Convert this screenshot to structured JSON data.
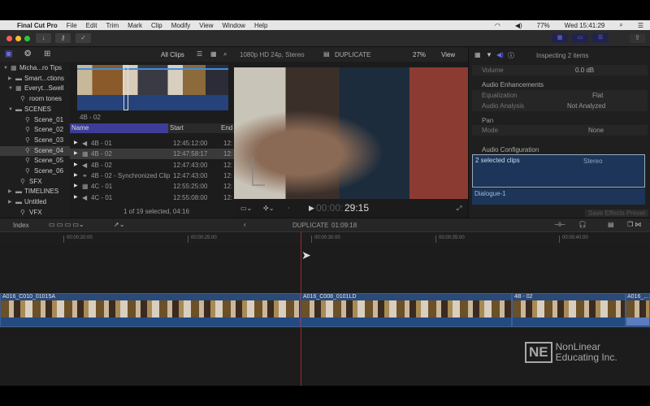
{
  "menubar": {
    "apple": "",
    "app": "Final Cut Pro",
    "items": [
      "File",
      "Edit",
      "Trim",
      "Mark",
      "Clip",
      "Modify",
      "View",
      "Window",
      "Help"
    ],
    "battery": "77%",
    "clock": "Wed 15:41:29"
  },
  "browser": {
    "filter": "All Clips",
    "sidebar": [
      {
        "label": "Micha...ro Tips",
        "indent": 0,
        "arrow": "▼",
        "icon": "library"
      },
      {
        "label": "Smart...ctions",
        "indent": 1,
        "arrow": "▶",
        "icon": "folder"
      },
      {
        "label": "Everyt...Swell",
        "indent": 1,
        "arrow": "▼",
        "icon": "event"
      },
      {
        "label": "room tones",
        "indent": 2,
        "arrow": "",
        "icon": "keyword"
      },
      {
        "label": "SCENES",
        "indent": 1,
        "arrow": "▼",
        "icon": "folder"
      },
      {
        "label": "Scene_01",
        "indent": 3,
        "arrow": "",
        "icon": "keyword"
      },
      {
        "label": "Scene_02",
        "indent": 3,
        "arrow": "",
        "icon": "keyword"
      },
      {
        "label": "Scene_03",
        "indent": 3,
        "arrow": "",
        "icon": "keyword"
      },
      {
        "label": "Scene_04",
        "indent": 3,
        "arrow": "",
        "icon": "keyword",
        "selected": true
      },
      {
        "label": "Scene_05",
        "indent": 3,
        "arrow": "",
        "icon": "keyword"
      },
      {
        "label": "Scene_06",
        "indent": 3,
        "arrow": "",
        "icon": "keyword"
      },
      {
        "label": "SFX",
        "indent": 2,
        "arrow": "",
        "icon": "keyword"
      },
      {
        "label": "TIMELINES",
        "indent": 1,
        "arrow": "▶",
        "icon": "folder"
      },
      {
        "label": "Untitled",
        "indent": 1,
        "arrow": "▶",
        "icon": "folder"
      },
      {
        "label": "VFX",
        "indent": 2,
        "arrow": "",
        "icon": "keyword"
      }
    ],
    "filmstrip_label": "4B - 02",
    "columns": [
      "Name",
      "Start",
      "End"
    ],
    "rows": [
      {
        "icon": "◀",
        "name": "4B - 01",
        "start": "12:45:12:00",
        "end": "12:"
      },
      {
        "icon": "▦",
        "name": "4B - 02",
        "start": "12:47:58:17",
        "end": "12:",
        "selected": true
      },
      {
        "icon": "◀",
        "name": "4B - 02",
        "start": "12:47:43:00",
        "end": "12:"
      },
      {
        "icon": "⚭",
        "name": "4B - 02 - Synchronized Clip",
        "start": "12:47:43:00",
        "end": "12:"
      },
      {
        "icon": "▦",
        "name": "4C - 01",
        "start": "12:55:25:00",
        "end": "12:"
      },
      {
        "icon": "◀",
        "name": "4C - 01",
        "start": "12:55:08:00",
        "end": "12:"
      }
    ],
    "footer": "1 of 19 selected, 04:16"
  },
  "viewer": {
    "format": "1080p HD 24p, Stereo",
    "project": "DUPLICATE",
    "zoom": "27%",
    "view": "View",
    "timecode_dim": "00:00:",
    "timecode": "29:15"
  },
  "inspector": {
    "title": "Inspecting 2 items",
    "volume_label": "Volume",
    "volume": "0.0 dB",
    "enh": "Audio Enhancements",
    "eq": "Equalization",
    "eq_val": "Flat",
    "analysis": "Audio Analysis",
    "analysis_val": "Not Analyzed",
    "pan": "Pan",
    "mode": "Mode",
    "mode_val": "None",
    "config": "Audio Configuration",
    "sel_clips": "2 selected clips",
    "stereo": "Stereo",
    "dialogue": "Dialogue-1",
    "save": "Save Effects Preset"
  },
  "timeline": {
    "index": "Index",
    "project": "DUPLICATE",
    "duration": "01:09:18",
    "ticks": [
      "00:00:20:00",
      "00:00:25:00",
      "00:00:30:00",
      "00:00:35:00",
      "00:00:40:00"
    ],
    "clips": [
      "A016_C010_01015A",
      "A016_C008_0101LD",
      "4B - 02",
      "A016_..."
    ]
  },
  "watermark": {
    "logo": "NE",
    "line1": "NonLinear",
    "line2": "Educating Inc."
  }
}
